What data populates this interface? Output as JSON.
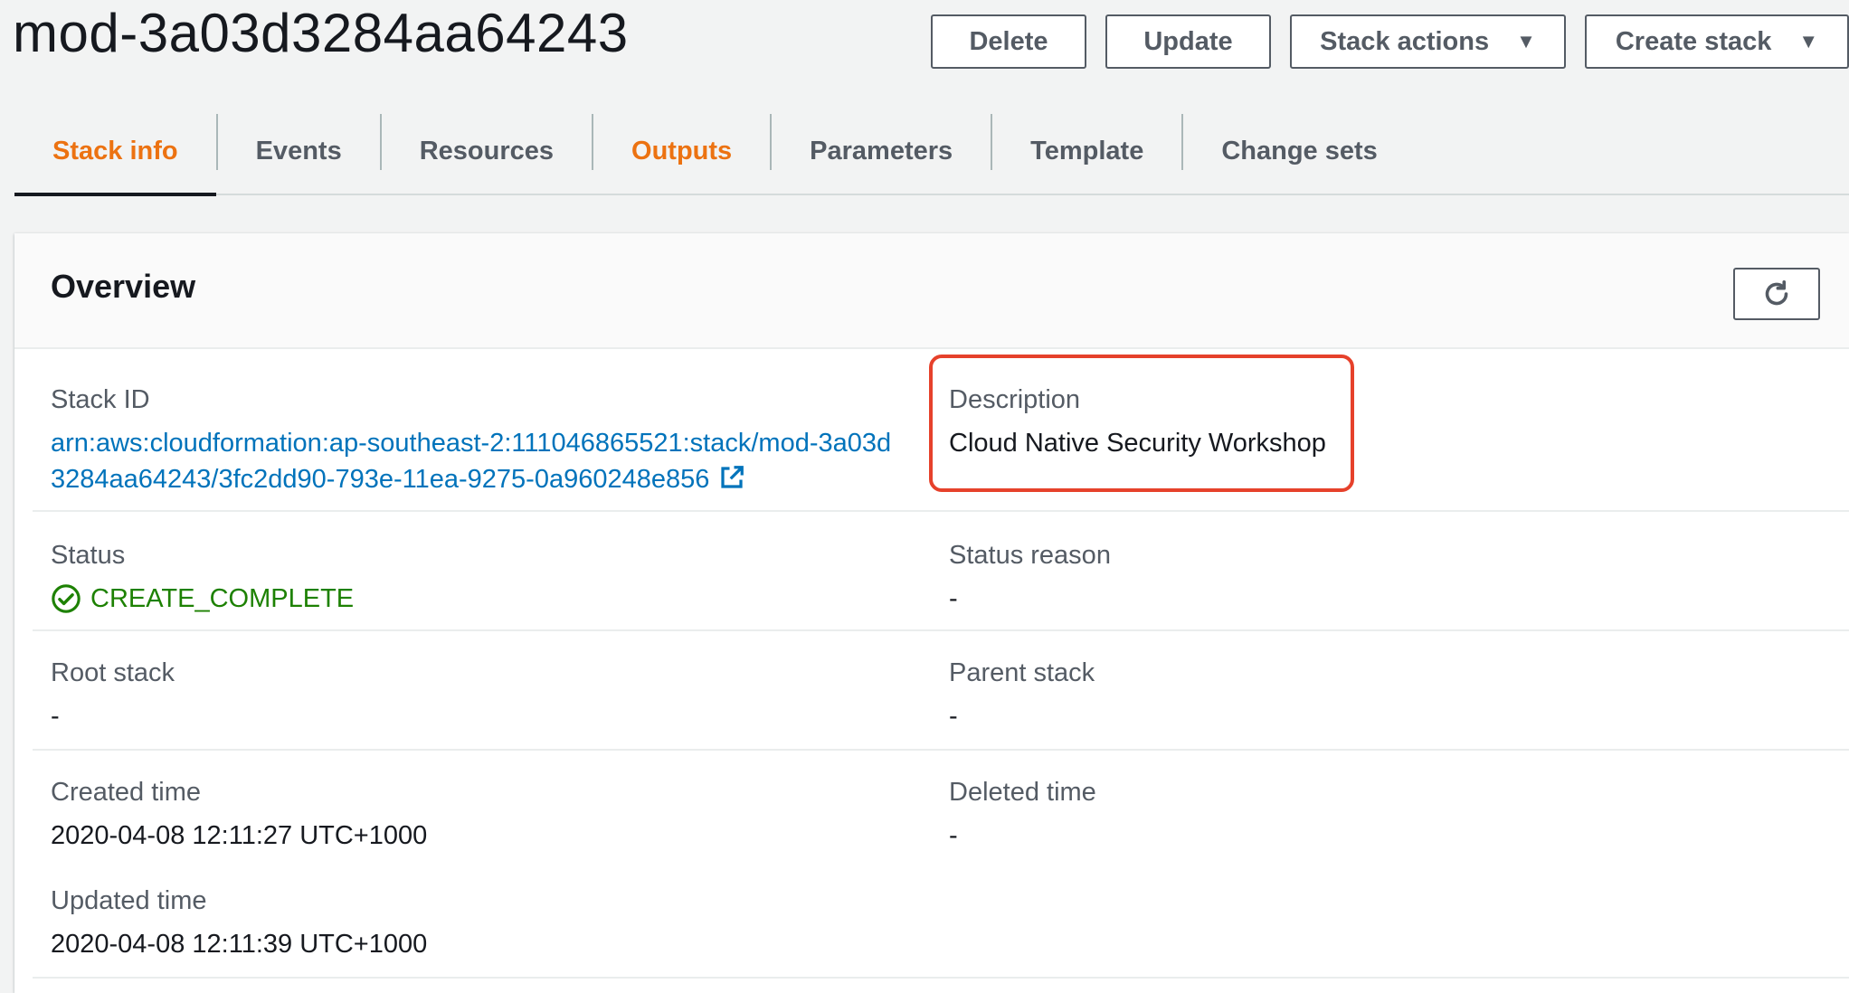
{
  "header": {
    "stack_name": "mod-3a03d3284aa64243",
    "buttons": {
      "delete": "Delete",
      "update": "Update",
      "stack_actions": "Stack actions",
      "create_stack": "Create stack"
    }
  },
  "tabs": [
    {
      "label": "Stack info",
      "active": true
    },
    {
      "label": "Events"
    },
    {
      "label": "Resources"
    },
    {
      "label": "Outputs"
    },
    {
      "label": "Parameters"
    },
    {
      "label": "Template"
    },
    {
      "label": "Change sets"
    }
  ],
  "overview": {
    "title": "Overview",
    "stack_id": {
      "label": "Stack ID",
      "value": "arn:aws:cloudformation:ap-southeast-2:111046865521:stack/mod-3a03d3284aa64243/3fc2dd90-793e-11ea-9275-0a960248e856"
    },
    "description": {
      "label": "Description",
      "value": "Cloud Native Security Workshop"
    },
    "status": {
      "label": "Status",
      "value": "CREATE_COMPLETE"
    },
    "status_reason": {
      "label": "Status reason",
      "value": "-"
    },
    "root_stack": {
      "label": "Root stack",
      "value": "-"
    },
    "parent_stack": {
      "label": "Parent stack",
      "value": "-"
    },
    "created_time": {
      "label": "Created time",
      "value": "2020-04-08 12:11:27 UTC+1000"
    },
    "deleted_time": {
      "label": "Deleted time",
      "value": "-"
    },
    "updated_time": {
      "label": "Updated time",
      "value": "2020-04-08 12:11:39 UTC+1000"
    }
  },
  "colors": {
    "accent_orange": "#ec7211",
    "link_blue": "#0073bb",
    "success_green": "#1d8102",
    "highlight_red": "#e6412b"
  }
}
